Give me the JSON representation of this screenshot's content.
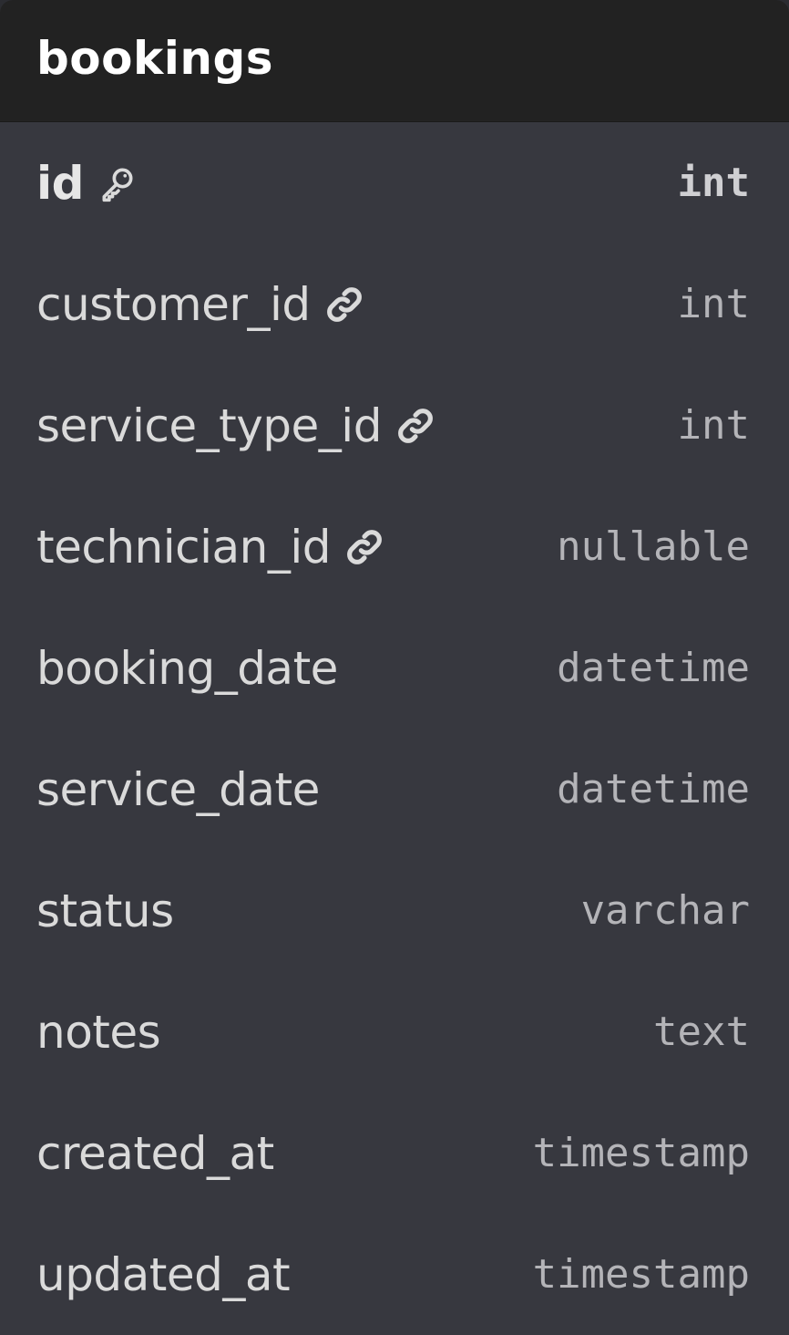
{
  "table": {
    "name": "bookings",
    "columns": [
      {
        "name": "id",
        "type": "int",
        "icon": "key-icon"
      },
      {
        "name": "customer_id",
        "type": "int",
        "icon": "link-icon"
      },
      {
        "name": "service_type_id",
        "type": "int",
        "icon": "link-icon"
      },
      {
        "name": "technician_id",
        "type": "nullable",
        "icon": "link-icon"
      },
      {
        "name": "booking_date",
        "type": "datetime"
      },
      {
        "name": "service_date",
        "type": "datetime"
      },
      {
        "name": "status",
        "type": "varchar"
      },
      {
        "name": "notes",
        "type": "text"
      },
      {
        "name": "created_at",
        "type": "timestamp"
      },
      {
        "name": "updated_at",
        "type": "timestamp"
      }
    ]
  },
  "colors": {
    "header_bg": "#222222",
    "body_bg": "#37383f",
    "title": "#ffffff",
    "column_name": "#dadada",
    "column_type": "#b4b4b8"
  }
}
